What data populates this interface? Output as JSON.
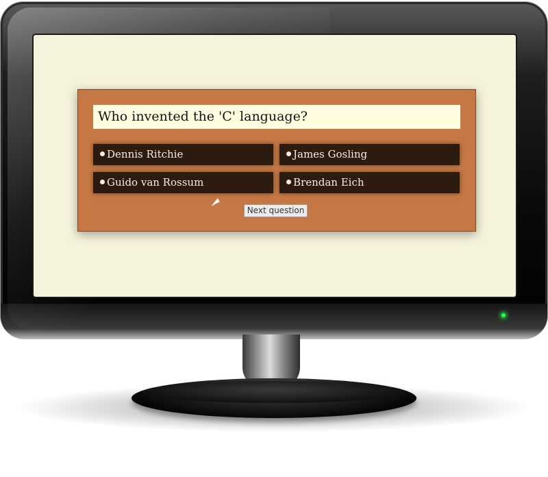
{
  "quiz": {
    "question": "Who invented the 'C' language?",
    "answers": [
      {
        "label": "Dennis Ritchie"
      },
      {
        "label": "James Gosling"
      },
      {
        "label": "Guido van Rossum"
      },
      {
        "label": "Brendan Eich"
      }
    ],
    "next_button": "Next question"
  },
  "colors": {
    "screen_bg": "#f6f3dc",
    "quiz_bg": "#c57843",
    "question_bg": "#fffce0",
    "answer_bg": "#2e1b0f",
    "power_led": "#1cff3a"
  },
  "icons": {
    "bullet": "white-dot",
    "cursor": "pointer-arrow"
  }
}
